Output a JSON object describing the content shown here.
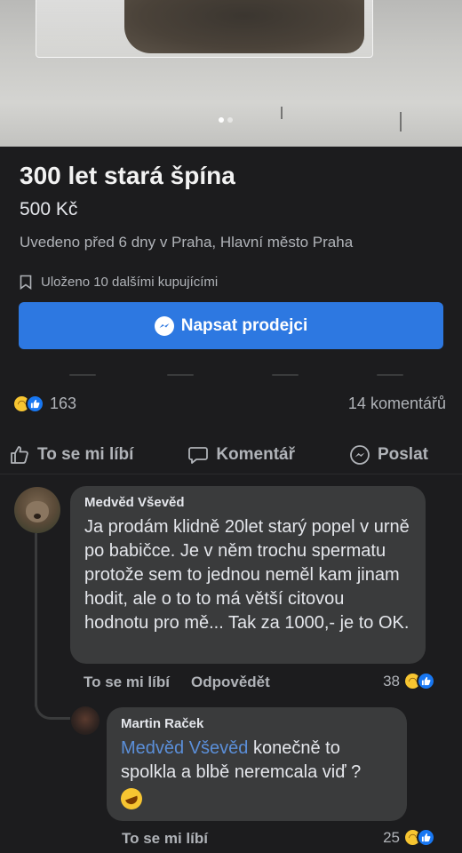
{
  "listing": {
    "title": "300 let stará špína",
    "price": "500 Kč",
    "listed": "Uvedeno před 6 dny v Praha, Hlavní město Praha",
    "saved": "Uloženo 10 dalšími kupujícími",
    "message_button": "Napsat prodejci"
  },
  "stats": {
    "reactions_count": "163",
    "comments_count": "14 komentářů"
  },
  "actions": {
    "like": "To se mi líbí",
    "comment": "Komentář",
    "share": "Poslat"
  },
  "comments": [
    {
      "author": "Medvěd Vševěd",
      "text": "Ja prodám klidně 20let starý popel v urně po babičce. Je v něm trochu spermatu protože sem to jednou neměl kam jinam hodit,  ale o to to má větší citovou hodnotu pro mě... Tak za 1000,- je to OK.",
      "like_label": "To se mi líbí",
      "reply_label": "Odpovědět",
      "reaction_count": "38"
    },
    {
      "author": "Martin Raček",
      "mention": "Medvěd Vševěd",
      "text": " konečně to spolkla a blbě neremcala viď ?",
      "like_label": "To se mi líbí",
      "reaction_count": "25"
    }
  ],
  "icons": {
    "photo_dots": "carousel-dots",
    "saved": "bookmark-icon",
    "messenger": "messenger-icon",
    "like": "thumbs-up-icon",
    "comment": "comment-icon",
    "share": "messenger-share-icon",
    "haha": "haha-reaction-icon",
    "laughing_emoji": "rolling-on-floor-laughing-emoji"
  },
  "colors": {
    "background": "#1c1c1e",
    "primary_button": "#2d78e1",
    "bubble": "#3a3b3c",
    "mention": "#5b8fd9"
  }
}
